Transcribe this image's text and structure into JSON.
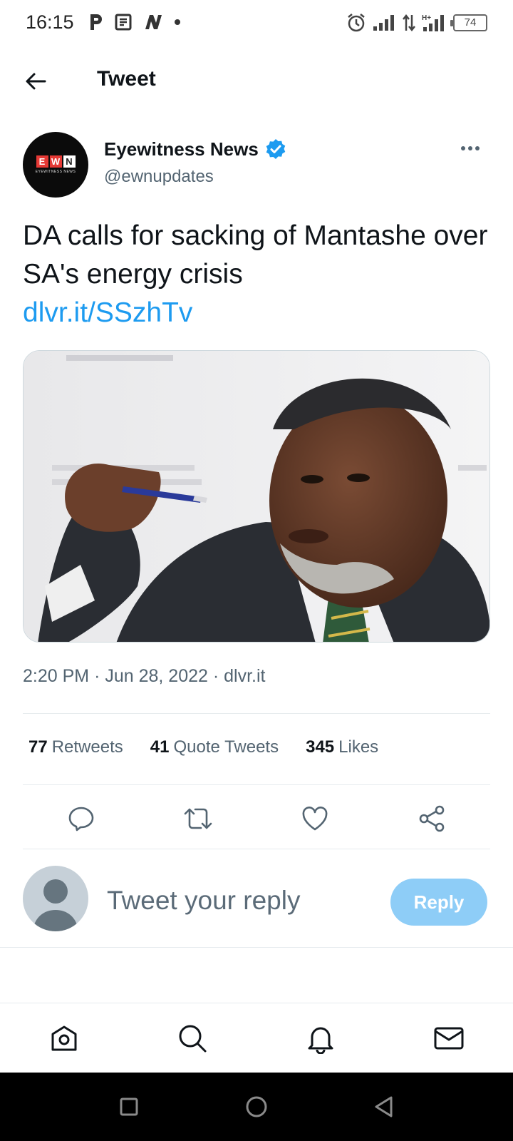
{
  "status_bar": {
    "time": "16:15",
    "battery": "74",
    "icons": [
      "p-icon",
      "news-icon",
      "n-icon",
      "dot-icon",
      "alarm-icon",
      "signal-icon",
      "data-arrows-icon",
      "hplus-signal-icon",
      "battery-icon"
    ]
  },
  "header": {
    "title": "Tweet",
    "back_icon": "arrow-left-icon"
  },
  "tweet": {
    "author_name": "Eyewitness News",
    "author_handle": "@ewnupdates",
    "avatar_logo": {
      "e": "E",
      "w": "W",
      "n": "N",
      "sub": "EYEWITNESS NEWS"
    },
    "verified": true,
    "text": "DA calls for sacking of Mantashe over SA's energy crisis",
    "link": "dlvr.it/SSzhTv",
    "time": "2:20 PM",
    "separator": "·",
    "date": "Jun 28, 2022",
    "source": "dlvr.it"
  },
  "stats": {
    "retweets_count": "77",
    "retweets_label": "Retweets",
    "quotes_count": "41",
    "quotes_label": "Quote Tweets",
    "likes_count": "345",
    "likes_label": "Likes"
  },
  "reply": {
    "placeholder": "Tweet your reply",
    "button_label": "Reply"
  },
  "colors": {
    "accent": "#1d9bf0",
    "reply_button_disabled": "#8ecdf7",
    "secondary_text": "#536471",
    "divider": "#e6ebee"
  }
}
